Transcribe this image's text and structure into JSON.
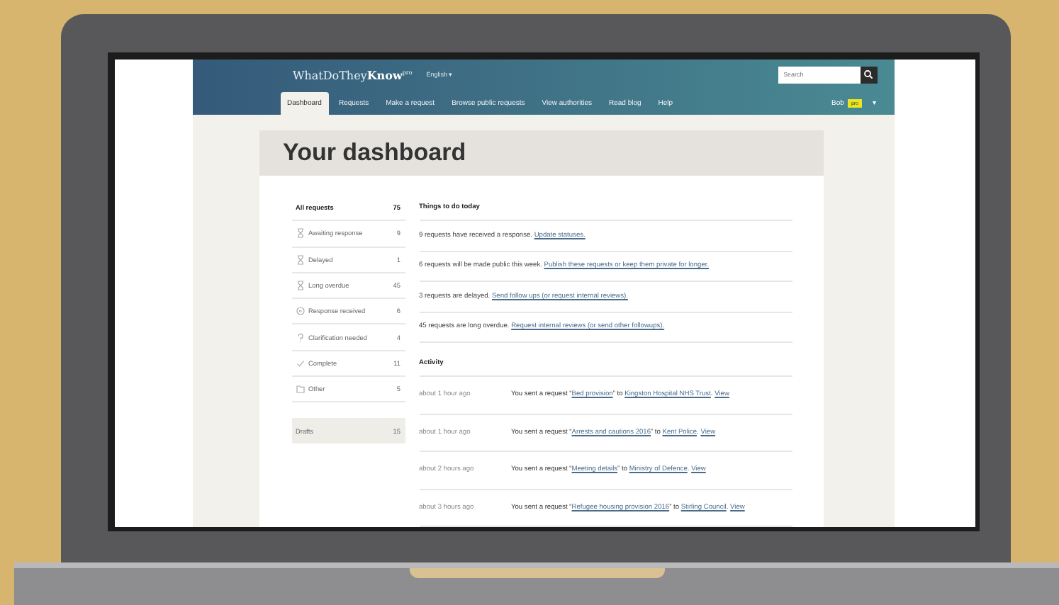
{
  "header": {
    "logo": "WhatDoThey**Know**$^{pro}$",
    "language": "English ▾",
    "search": {
      "placeholder": "Search"
    }
  },
  "nav": [
    {
      "label": "Dashboard",
      "selected": true
    },
    {
      "label": "Requests",
      "selected": false
    },
    {
      "label": "Make a request",
      "selected": false
    },
    {
      "label": "Browse public requests",
      "selected": false
    },
    {
      "label": "View authorities",
      "selected": false
    },
    {
      "label": "Read blog",
      "selected": false
    },
    {
      "label": "Help",
      "selected": false
    }
  ],
  "user": {
    "name": "Bob",
    "badge": "pro",
    "caret": "▾"
  },
  "title": "Your dashboard",
  "sidebar": {
    "header": {
      "label": "All requests",
      "count": "75"
    },
    "items": [
      {
        "kind": "hourglass",
        "label": "Awaiting response",
        "count": "9"
      },
      {
        "kind": "hourglass",
        "label": "Delayed",
        "count": "1"
      },
      {
        "kind": "hourglass",
        "label": "Long overdue",
        "count": "45"
      },
      {
        "kind": "reply",
        "label": "Response received",
        "count": "6"
      },
      {
        "kind": "question",
        "label": "Clarification needed",
        "count": "4"
      },
      {
        "kind": "check",
        "label": "Complete",
        "count": "11"
      },
      {
        "kind": "folder",
        "label": "Other",
        "count": "5"
      }
    ],
    "drafts": {
      "label": "Drafts",
      "count": "15"
    }
  },
  "todo": {
    "heading": "Things to do today",
    "items": [
      {
        "text": "9 requests have received a response.",
        "link": "Update statuses."
      },
      {
        "text": "6 requests will be made public this week.",
        "link": "Publish these requests or keep them private for longer."
      },
      {
        "text": "3 requests are delayed.",
        "link": "Send follow ups (or request internal reviews)."
      },
      {
        "text": "45 requests are long overdue.",
        "link": "Request internal reviews (or send other followups)."
      }
    ]
  },
  "activity": {
    "heading": "Activity",
    "rows": [
      {
        "time": "about 1 hour ago",
        "lead": "You sent a request “",
        "title": "Bed provision",
        "mid": "” to",
        "authority": "Kingston Hospital NHS Trust",
        "tail": ".",
        "view": "View"
      },
      {
        "time": "about 1 hour ago",
        "lead": "You sent a request “",
        "title": "Arrests and cautions 2016",
        "mid": "” to",
        "authority": "Kent Police",
        "tail": ".",
        "view": "View"
      },
      {
        "time": "about 2 hours ago",
        "lead": "You sent a request “",
        "title": "Meeting details",
        "mid": "” to",
        "authority": "Ministry of Defence",
        "tail": ".",
        "view": "View"
      },
      {
        "time": "about 3 hours ago",
        "lead": "You sent a request “",
        "title": "Refugee housing provision 2016",
        "mid": "” to",
        "authority": "Stirling Council",
        "tail": ".",
        "view": "View"
      }
    ]
  }
}
